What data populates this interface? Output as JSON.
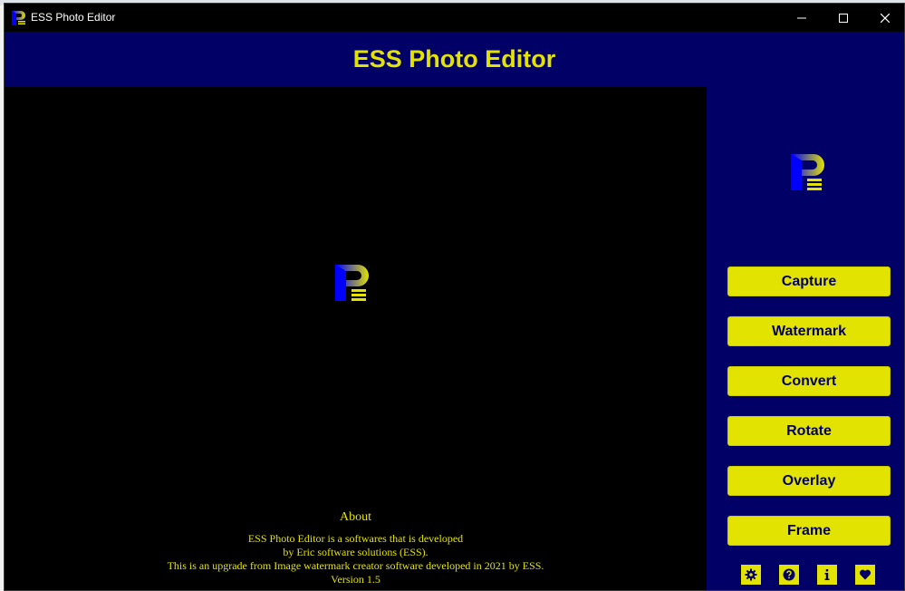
{
  "window": {
    "title": "ESS Photo Editor",
    "controls": {
      "minimize_icon": "minimize-icon",
      "maximize_icon": "maximize-icon",
      "close_icon": "close-icon"
    }
  },
  "header": {
    "title": "ESS Photo Editor"
  },
  "about": {
    "title": "About",
    "lines": [
      "ESS Photo Editor is a softwares that is developed",
      "by Eric software solutions (ESS).",
      "This is an upgrade from Image watermark creator software developed in 2021 by ESS.",
      "Version 1.5"
    ]
  },
  "sidebar": {
    "buttons": [
      {
        "label": "Capture"
      },
      {
        "label": "Watermark"
      },
      {
        "label": "Convert"
      },
      {
        "label": "Rotate"
      },
      {
        "label": "Overlay"
      },
      {
        "label": "Frame"
      }
    ],
    "utility_icons": [
      "gear-icon",
      "help-icon",
      "info-icon",
      "heart-icon"
    ]
  },
  "colors": {
    "app_background": "#000066",
    "accent_yellow": "#e2e300",
    "canvas_background": "#000000",
    "titlebar": "#000000"
  }
}
